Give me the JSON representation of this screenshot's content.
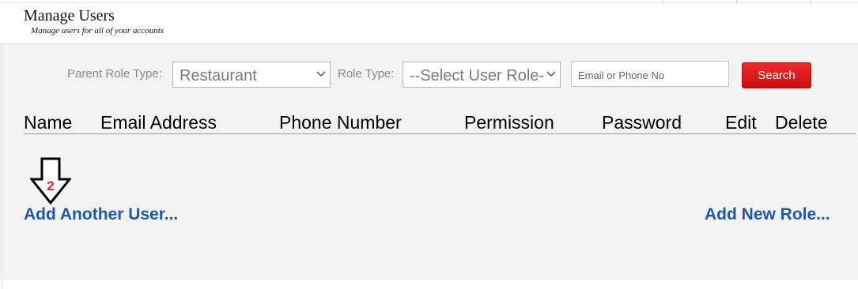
{
  "header": {
    "title": "Manage Users",
    "subtitle": "Manage users for all of your accounts"
  },
  "filters": {
    "parent_role_type_label": "Parent Role Type:",
    "parent_role_type_value": "Restaurant",
    "role_type_label": "Role Type:",
    "role_type_value": "--Select User Role--",
    "search_placeholder": "Email or Phone No",
    "search_button": "Search"
  },
  "table": {
    "columns": [
      "Name",
      "Email Address",
      "Phone Number",
      "Permission",
      "Password",
      "Edit",
      "Delete"
    ]
  },
  "annotation": {
    "step_number": "2"
  },
  "actions": {
    "add_user": "Add Another User...",
    "add_role": "Add New Role..."
  },
  "colors": {
    "accent_link": "#1e58a6",
    "search_button": "#dd1a1a",
    "annotation_number": "#e8202a"
  }
}
